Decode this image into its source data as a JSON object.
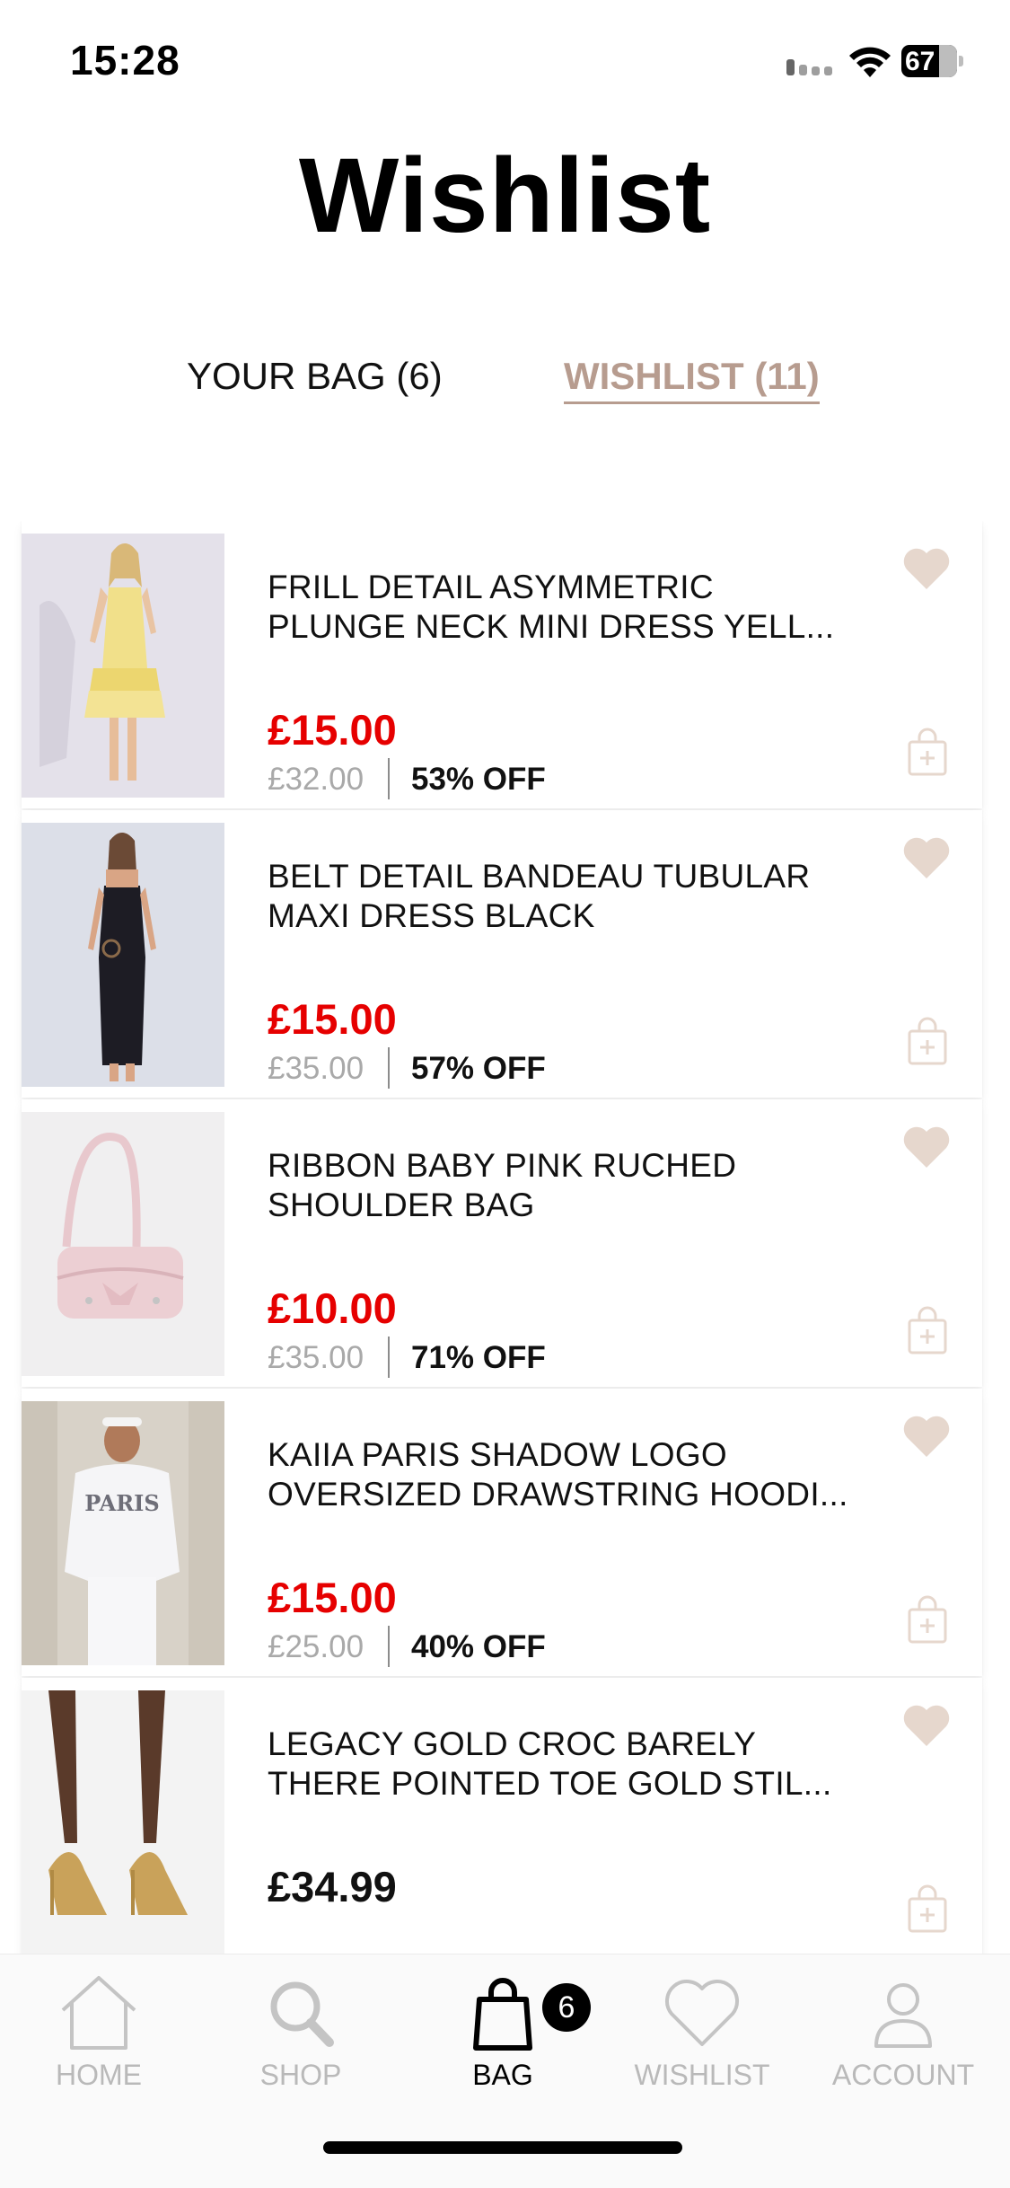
{
  "status_bar": {
    "time": "15:28",
    "battery": "67"
  },
  "page": {
    "title": "Wishlist"
  },
  "tabs": [
    {
      "label": "YOUR BAG (6)",
      "active": false
    },
    {
      "label": "WISHLIST (11)",
      "active": true
    }
  ],
  "items": [
    {
      "name_line1": "FRILL DETAIL ASYMMETRIC",
      "name_line2": "PLUNGE NECK MINI DRESS YELL...",
      "price": "£15.00",
      "original_price": "£32.00",
      "discount": "53% OFF"
    },
    {
      "name_line1": "BELT DETAIL BANDEAU TUBULAR",
      "name_line2": "MAXI DRESS BLACK",
      "price": "£15.00",
      "original_price": "£35.00",
      "discount": "57% OFF"
    },
    {
      "name_line1": "RIBBON BABY PINK RUCHED",
      "name_line2": "SHOULDER BAG",
      "price": "£10.00",
      "original_price": "£35.00",
      "discount": "71% OFF"
    },
    {
      "name_line1": "KAIIA PARIS SHADOW LOGO",
      "name_line2": "OVERSIZED DRAWSTRING HOODI...",
      "price": "£15.00",
      "original_price": "£25.00",
      "discount": "40% OFF"
    },
    {
      "name_line1": "LEGACY GOLD CROC BARELY",
      "name_line2": "THERE POINTED TOE GOLD STIL...",
      "price": "£34.99"
    }
  ],
  "product_image_text": {
    "hoodie_print": "PARIS"
  },
  "bottom_nav": {
    "home": "HOME",
    "shop": "SHOP",
    "bag": "BAG",
    "bag_count": "6",
    "wishlist": "WISHLIST",
    "account": "ACCOUNT"
  },
  "colors": {
    "accent": "#b79c8f",
    "sale_price": "#e60000",
    "icon_tint": "#e6d7cd"
  },
  "icons": {
    "wishlist_heart": "heart-icon",
    "add_to_bag": "add-to-bag-icon",
    "home": "home-icon",
    "shop": "search-icon",
    "bag": "shopping-bag-icon",
    "wishlist": "heart-outline-icon",
    "account": "user-icon"
  }
}
